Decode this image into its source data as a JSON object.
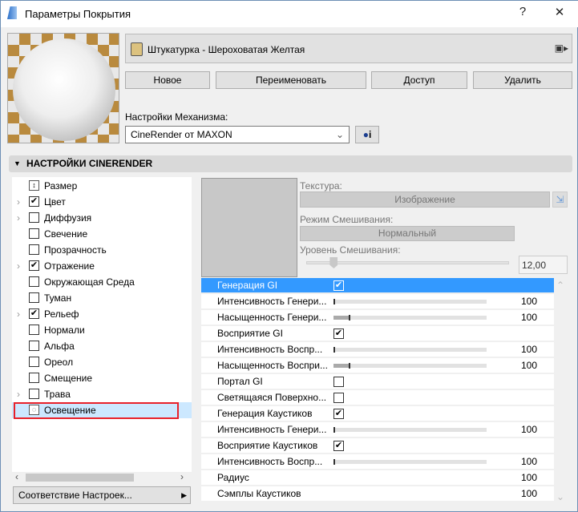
{
  "window": {
    "title": "Параметры Покрытия",
    "help": "?",
    "close": "✕"
  },
  "material": {
    "name": "Штукатурка - Шероховатая Желтая",
    "swatch_color": "#dcc27f"
  },
  "buttons": {
    "new": "Новое",
    "rename": "Переименовать",
    "access": "Доступ",
    "delete": "Удалить"
  },
  "engine": {
    "label": "Настройки Механизма:",
    "value": "CineRender от MAXON",
    "info": "i"
  },
  "section": {
    "title": "НАСТРОЙКИ CINERENDER"
  },
  "channels": [
    {
      "label": "Размер",
      "type": "icon",
      "expand": false
    },
    {
      "label": "Цвет",
      "checked": true,
      "expand": true
    },
    {
      "label": "Диффузия",
      "checked": false,
      "expand": true
    },
    {
      "label": "Свечение",
      "checked": false,
      "expand": false
    },
    {
      "label": "Прозрачность",
      "checked": false,
      "expand": false
    },
    {
      "label": "Отражение",
      "checked": true,
      "expand": true
    },
    {
      "label": "Окружающая Среда",
      "checked": false,
      "expand": false
    },
    {
      "label": "Туман",
      "checked": false,
      "expand": false
    },
    {
      "label": "Рельеф",
      "checked": true,
      "expand": true
    },
    {
      "label": "Нормали",
      "checked": false,
      "expand": false
    },
    {
      "label": "Альфа",
      "checked": false,
      "expand": false
    },
    {
      "label": "Ореол",
      "checked": false,
      "expand": false
    },
    {
      "label": "Смещение",
      "checked": false,
      "expand": false
    },
    {
      "label": "Трава",
      "checked": false,
      "expand": true
    },
    {
      "label": "Освещение",
      "type": "icon",
      "selected": true
    }
  ],
  "match_button": "Соответствие Настроек...",
  "texture": {
    "label": "Текстура:",
    "value": "Изображение",
    "blend_label": "Режим Смешивания:",
    "blend_value": "Нормальный",
    "level_label": "Уровень Смешивания:",
    "level_value": "12,00",
    "level_fraction": 0.12
  },
  "properties": [
    {
      "label": "Генерация GI",
      "type": "check",
      "checked": true,
      "selected": true
    },
    {
      "label": "Интенсивность Генери...",
      "type": "slider",
      "fill": 0.0,
      "value": "100"
    },
    {
      "label": "Насыщенность Генери...",
      "type": "slider",
      "fill": 0.1,
      "value": "100"
    },
    {
      "label": "Восприятие GI",
      "type": "check",
      "checked": true
    },
    {
      "label": "Интенсивность Воспр...",
      "type": "slider",
      "fill": 0.0,
      "value": "100"
    },
    {
      "label": "Насыщенность Воспри...",
      "type": "slider",
      "fill": 0.1,
      "value": "100"
    },
    {
      "label": "Портал GI",
      "type": "check",
      "checked": false
    },
    {
      "label": "Светящаяся Поверхно...",
      "type": "check",
      "checked": false
    },
    {
      "label": "Генерация Каустиков",
      "type": "check",
      "checked": true
    },
    {
      "label": "Интенсивность Генери...",
      "type": "slider",
      "fill": 0.0,
      "value": "100"
    },
    {
      "label": "Восприятие Каустиков",
      "type": "check",
      "checked": true
    },
    {
      "label": "Интенсивность Воспр...",
      "type": "slider",
      "fill": 0.0,
      "value": "100"
    },
    {
      "label": "Радиус",
      "type": "value",
      "value": "100"
    },
    {
      "label": "Сэмплы Каустиков",
      "type": "value",
      "value": "100"
    }
  ]
}
